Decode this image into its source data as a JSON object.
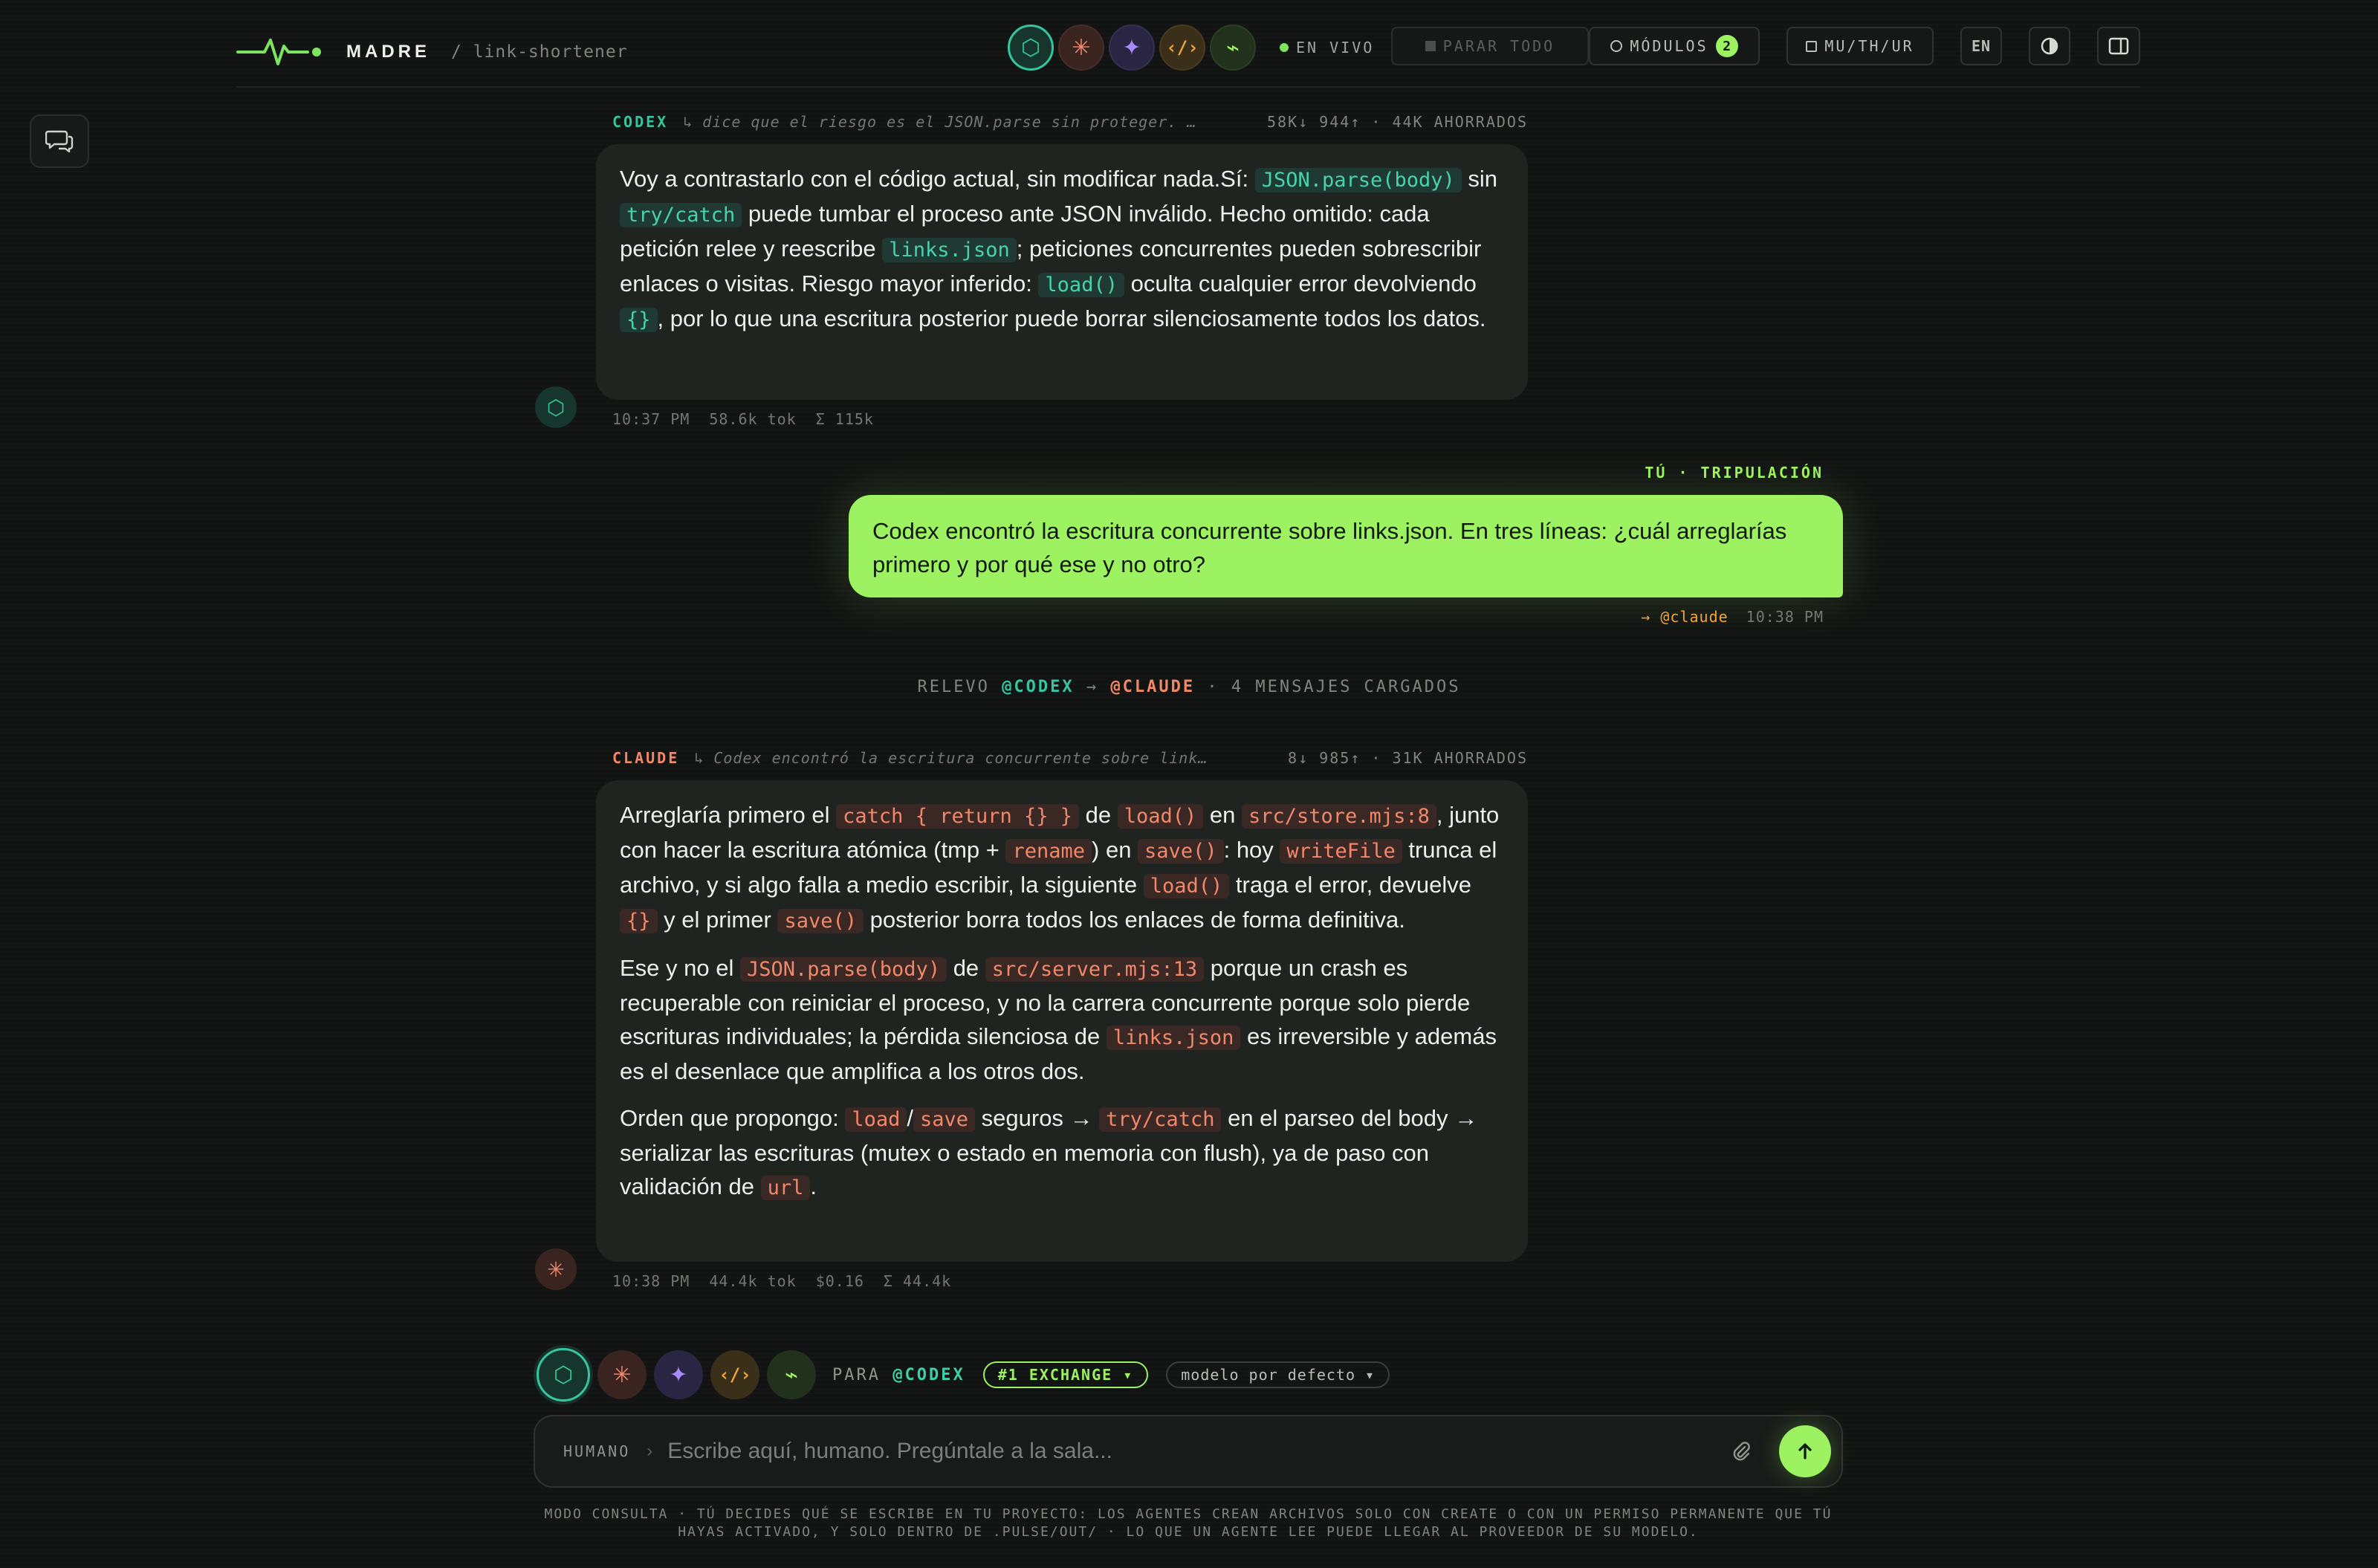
{
  "header": {
    "brand": "MADRE",
    "project_path": "/ link-shortener",
    "agents": [
      {
        "name": "codex",
        "glyph": "⬡",
        "color": "#35c6a0",
        "bg": "#16352d"
      },
      {
        "name": "claude",
        "glyph": "✳",
        "color": "#f2886a",
        "bg": "#3a2420"
      },
      {
        "name": "gemini",
        "glyph": "✦",
        "color": "#a78bfa",
        "bg": "#2a2542"
      },
      {
        "name": "code",
        "glyph": "‹/›",
        "color": "#f0a63a",
        "bg": "#3a2f18"
      },
      {
        "name": "pulse",
        "glyph": "⌁",
        "color": "#9df261",
        "bg": "#22311c"
      }
    ],
    "live_label": "EN VIVO",
    "stop_all_label": "PARAR TODO",
    "modules_label": "MÓDULOS",
    "modules_count": "2",
    "schedule_label": "MU/TH/UR",
    "lang_label": "EN"
  },
  "messages": {
    "codex": {
      "author": "CODEX",
      "reply_to": "↳ dice que el riesgo es el JSON.parse sin proteger. …",
      "stats": "58K↓ 944↑ · 44K AHORRADOS",
      "time": "10:37 PM",
      "tokens": "58.6k tok",
      "total": "Σ 115k",
      "t1": "Voy a contrastarlo con el código actual, sin modificar nada.Sí: ",
      "c1": "JSON.parse(body)",
      "t2": " sin ",
      "c2": "try/catch",
      "t3": " puede tumbar el proceso ante JSON inválido. Hecho omitido: cada petición relee y reescribe ",
      "c3": "links.json",
      "t4": "; peticiones concurrentes pueden sobrescribir enlaces o visitas. Riesgo mayor inferido: ",
      "c4": "load()",
      "t5": " oculta cualquier error devolviendo ",
      "c5": "{}",
      "t6": ", por lo que una escritura posterior puede borrar silenciosamente todos los datos."
    },
    "user": {
      "tag": "TÚ · TRIPULACIÓN",
      "text": "Codex encontró la escritura concurrente sobre links.json. En tres líneas: ¿cuál arreglarías primero y por qué ese y no otro?",
      "mention": "→ @claude",
      "time": "10:38 PM"
    },
    "relay": {
      "prefix": "RELEVO ",
      "from": "@CODEX",
      "arrow": " → ",
      "to": "@CLAUDE",
      "suffix": " · 4 MENSAJES CARGADOS"
    },
    "claude": {
      "author": "CLAUDE",
      "reply_to": "↳ Codex encontró la escritura concurrente sobre link…",
      "stats": "8↓ 985↑ · 31K AHORRADOS",
      "time": "10:38 PM",
      "tokens": "44.4k tok",
      "cost": "$0.16",
      "total": "Σ 44.4k",
      "p1": {
        "t1": "Arreglaría primero el ",
        "c1": "catch { return {} }",
        "t2": " de ",
        "c2": "load()",
        "t3": " en ",
        "c3": "src/store.mjs:8",
        "t4": ", junto con hacer la escritura atómica (tmp + ",
        "c4": "rename",
        "t5": ") en ",
        "c5": "save()",
        "t6": ": hoy ",
        "c6": "writeFile",
        "t7": " trunca el archivo, y si algo falla a medio escribir, la siguiente ",
        "c7": "load()",
        "t8": " traga el error, devuelve ",
        "c8": "{}",
        "t9": " y el primer ",
        "c9": "save()",
        "t10": " posterior borra todos los enlaces de forma definitiva."
      },
      "p2": {
        "t1": "Ese y no el ",
        "c1": "JSON.parse(body)",
        "t2": " de ",
        "c2": "src/server.mjs:13",
        "t3": " porque un crash es recuperable con reiniciar el proceso, y no la carrera concurrente porque solo pierde escrituras individuales; la pérdida silenciosa de ",
        "c3": "links.json",
        "t4": " es irreversible y además es el desenlace que amplifica a los otros dos."
      },
      "p3": {
        "t1": "Orden que propongo: ",
        "c1": "load",
        "t2": "/",
        "c2": "save",
        "t3": " seguros → ",
        "c3": "try/catch",
        "t4": " en el parseo del body → serializar las escrituras (mutex o estado en memoria con flush), ya de paso con validación de ",
        "c4": "url",
        "t5": "."
      }
    }
  },
  "composer": {
    "para_label": "PARA",
    "target": "@CODEX",
    "exchange_label": "#1 EXCHANGE ▾",
    "model_label": "modelo por defecto ▾",
    "input_label": "HUMANO",
    "input_sep": "›",
    "placeholder": "Escribe aquí, humano. Pregúntale a la sala...",
    "disclaimer": "MODO CONSULTA · TÚ DECIDES QUÉ SE ESCRIBE EN TU PROYECTO: LOS AGENTES CREAN ARCHIVOS SOLO CON CREATE O CON UN PERMISO PERMANENTE QUE TÚ HAYAS ACTIVADO, Y SOLO DENTRO DE .PULSE/OUT/ · LO QUE UN AGENTE LEE PUEDE LLEGAR AL PROVEEDOR DE SU MODELO."
  }
}
